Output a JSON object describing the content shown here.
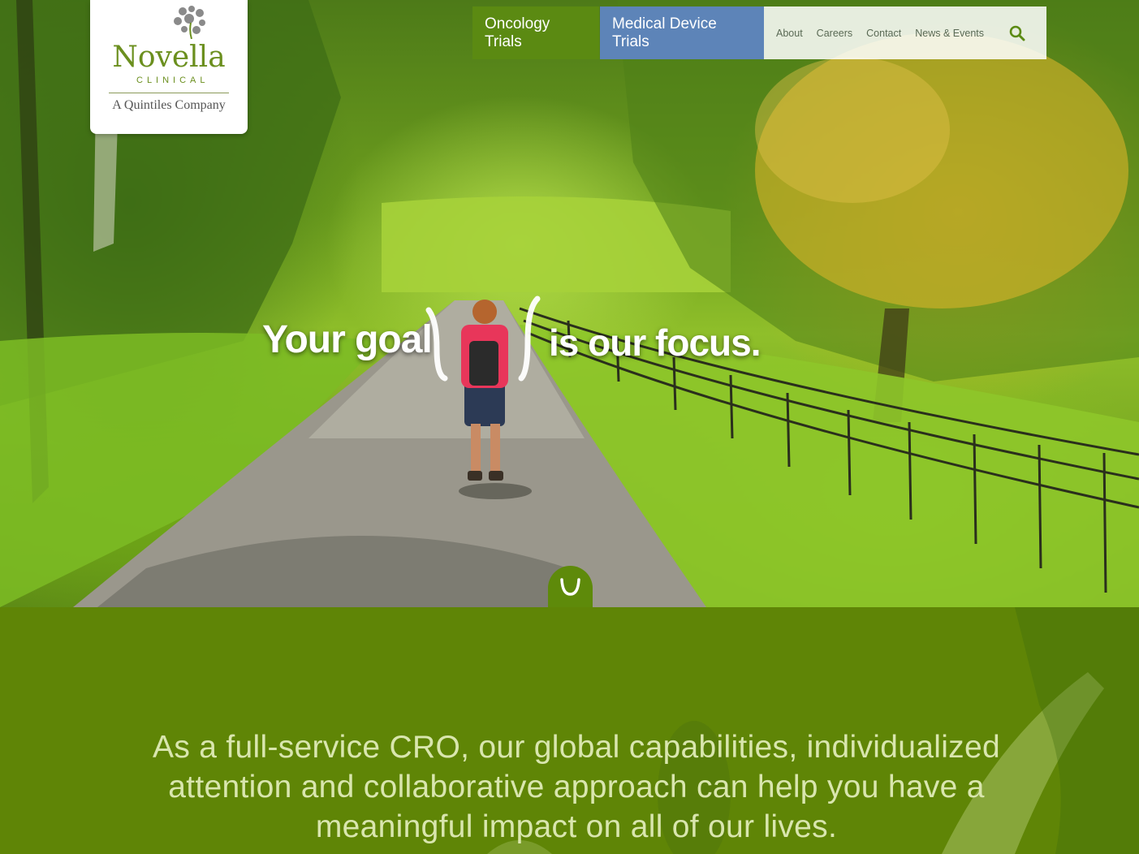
{
  "logo": {
    "wordmark": "Novella",
    "sub": "CLINICAL",
    "tagline": "A Quintiles Company"
  },
  "nav": {
    "primary": [
      {
        "label": "Oncology Trials",
        "color": "#5b8a12"
      },
      {
        "label": "Medical Device Trials",
        "color": "#5d84b8"
      }
    ],
    "secondary": [
      "About",
      "Careers",
      "Contact",
      "News & Events"
    ],
    "search_icon": "search-icon"
  },
  "hero": {
    "headline_left": "Your goal",
    "headline_right": "is our focus.",
    "scroll_icon": "chevron-down-icon"
  },
  "intro": {
    "text": "As a full-service CRO, our global capabilities, individualized attention and collaborative approach can help you have a meaningful impact on all of our lives."
  },
  "colors": {
    "brand_green": "#5f8506",
    "intro_text": "#d9e6ae"
  }
}
